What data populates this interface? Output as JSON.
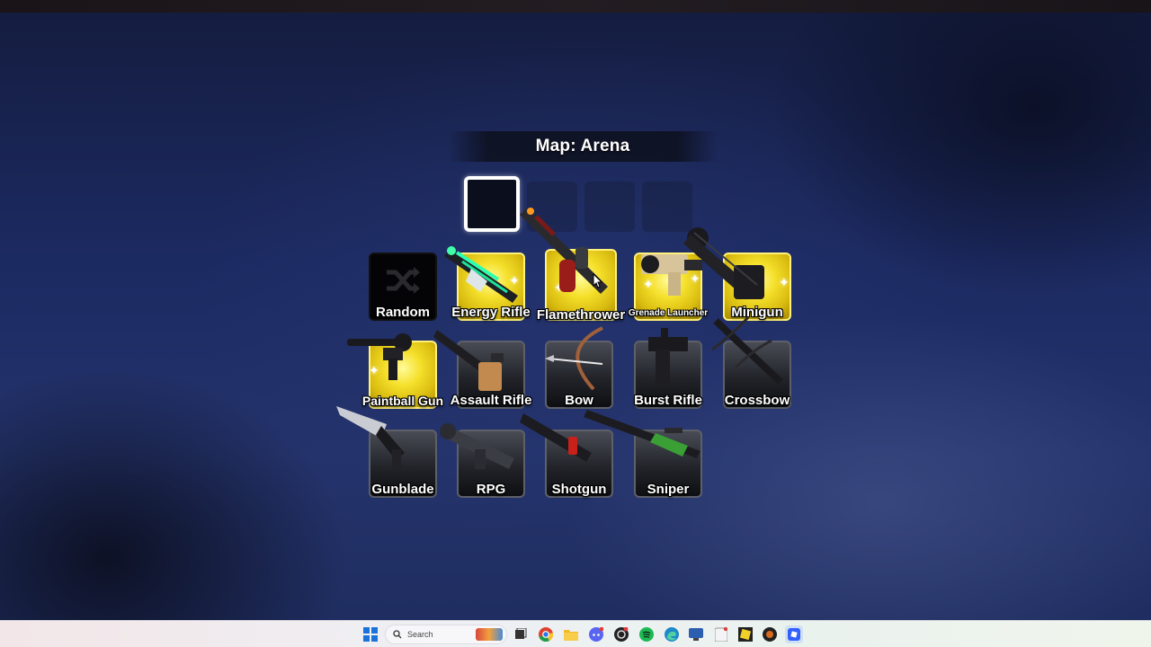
{
  "map": {
    "title": "Map: Arena"
  },
  "random": {
    "label": "Random"
  },
  "weapons": [
    {
      "label": "Energy Rifle",
      "rarity": "gold"
    },
    {
      "label": "Flamethrower",
      "rarity": "gold"
    },
    {
      "label": "Grenade Launcher",
      "rarity": "gold"
    },
    {
      "label": "Minigun",
      "rarity": "gold"
    },
    {
      "label": "Paintball Gun",
      "rarity": "gold"
    },
    {
      "label": "Assault Rifle",
      "rarity": "common"
    },
    {
      "label": "Bow",
      "rarity": "common"
    },
    {
      "label": "Burst Rifle",
      "rarity": "common"
    },
    {
      "label": "Crossbow",
      "rarity": "common"
    },
    {
      "label": "Gunblade",
      "rarity": "common"
    },
    {
      "label": "RPG",
      "rarity": "common"
    },
    {
      "label": "Shotgun",
      "rarity": "common"
    },
    {
      "label": "Sniper",
      "rarity": "common"
    }
  ],
  "taskbar": {
    "search_placeholder": "Search",
    "icons": [
      "windows-start-icon",
      "search-icon",
      "task-view-icon",
      "chrome-icon",
      "file-explorer-icon",
      "discord-icon",
      "game-app-icon",
      "spotify-icon",
      "edge-icon",
      "remote-desktop-icon",
      "notepad-icon",
      "roblox-studio-icon",
      "obs-icon",
      "roblox-icon"
    ]
  },
  "colors": {
    "gold_tile": "#f5e02b",
    "dark_tile": "#22242a",
    "selected_slot_border": "#ffffff"
  }
}
